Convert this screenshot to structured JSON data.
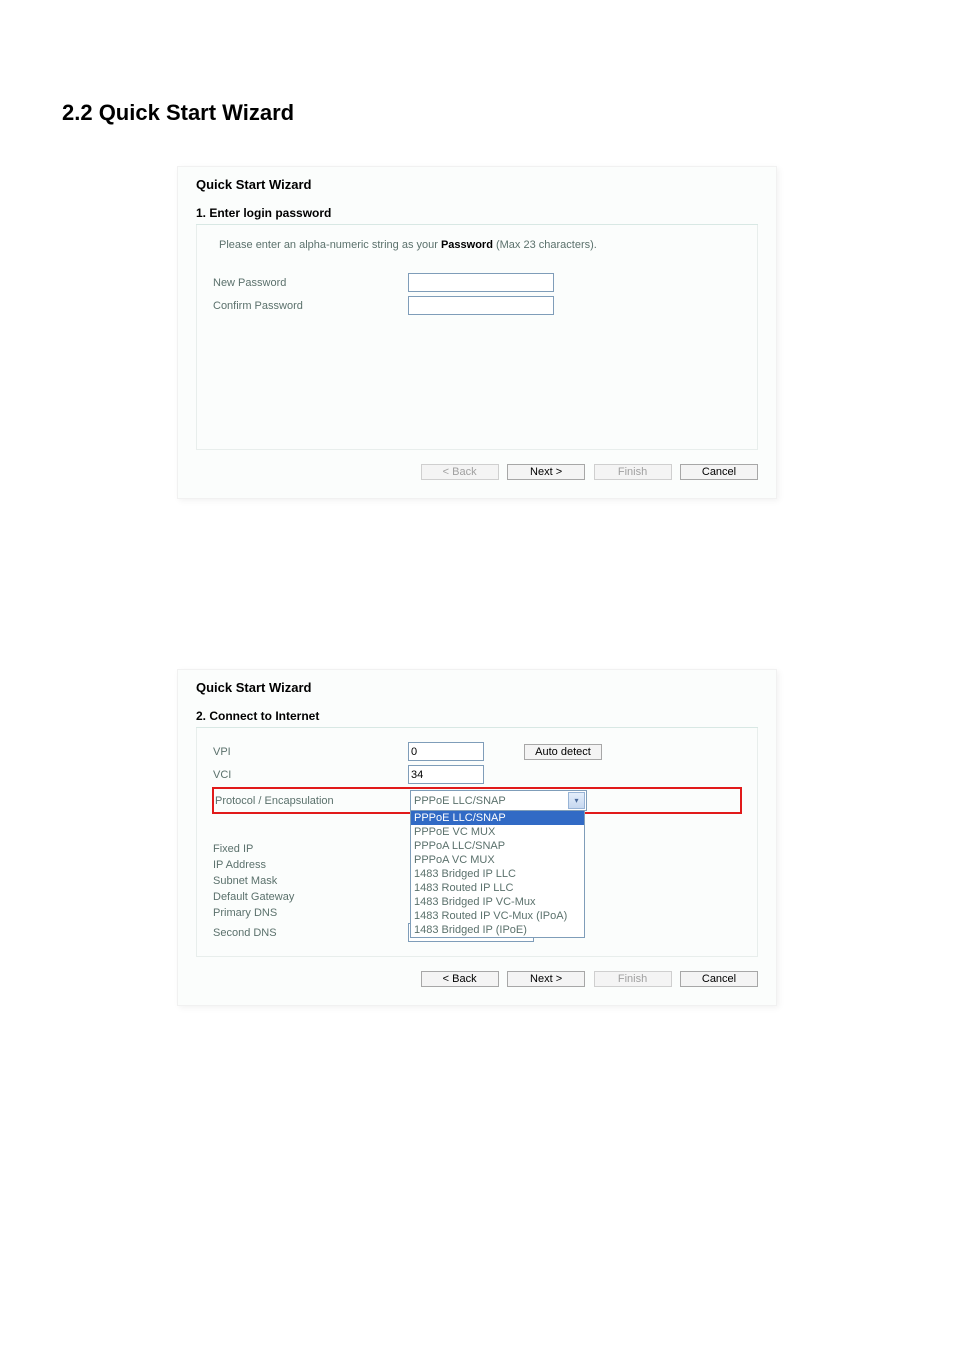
{
  "section_heading": "2.2 Quick Start Wizard",
  "wizard1": {
    "wizard_title": "Quick Start Wizard",
    "step_title": "1. Enter login password",
    "hint_pre": "Please enter an alpha-numeric string as your ",
    "hint_bold": "Password",
    "hint_post": " (Max 23 characters).",
    "new_password_label": "New Password",
    "confirm_password_label": "Confirm Password",
    "new_password_value": "",
    "confirm_password_value": "",
    "buttons": {
      "back": "< Back",
      "next": "Next >",
      "finish": "Finish",
      "cancel": "Cancel"
    }
  },
  "wizard2": {
    "wizard_title": "Quick Start Wizard",
    "step_title": "2. Connect to Internet",
    "vpi_label": "VPI",
    "vpi_value": "0",
    "auto_detect_label": "Auto detect",
    "vci_label": "VCI",
    "vci_value": "34",
    "proto_label": "Protocol / Encapsulation",
    "proto_selected": "PPPoE LLC/SNAP",
    "proto_options": [
      "PPPoE LLC/SNAP",
      "PPPoE VC MUX",
      "PPPoA LLC/SNAP",
      "PPPoA VC MUX",
      "1483 Bridged IP LLC",
      "1483 Routed IP LLC",
      "1483 Bridged IP VC-Mux",
      "1483 Routed IP VC-Mux (IPoA)",
      "1483 Bridged IP (IPoE)"
    ],
    "fixed_ip_label": "Fixed IP",
    "ip_address_label": "IP Address",
    "subnet_mask_label": "Subnet Mask",
    "default_gateway_label": "Default Gateway",
    "primary_dns_label": "Primary DNS",
    "second_dns_label": "Second DNS",
    "second_dns_value": "",
    "buttons": {
      "back": "< Back",
      "next": "Next >",
      "finish": "Finish",
      "cancel": "Cancel"
    }
  }
}
